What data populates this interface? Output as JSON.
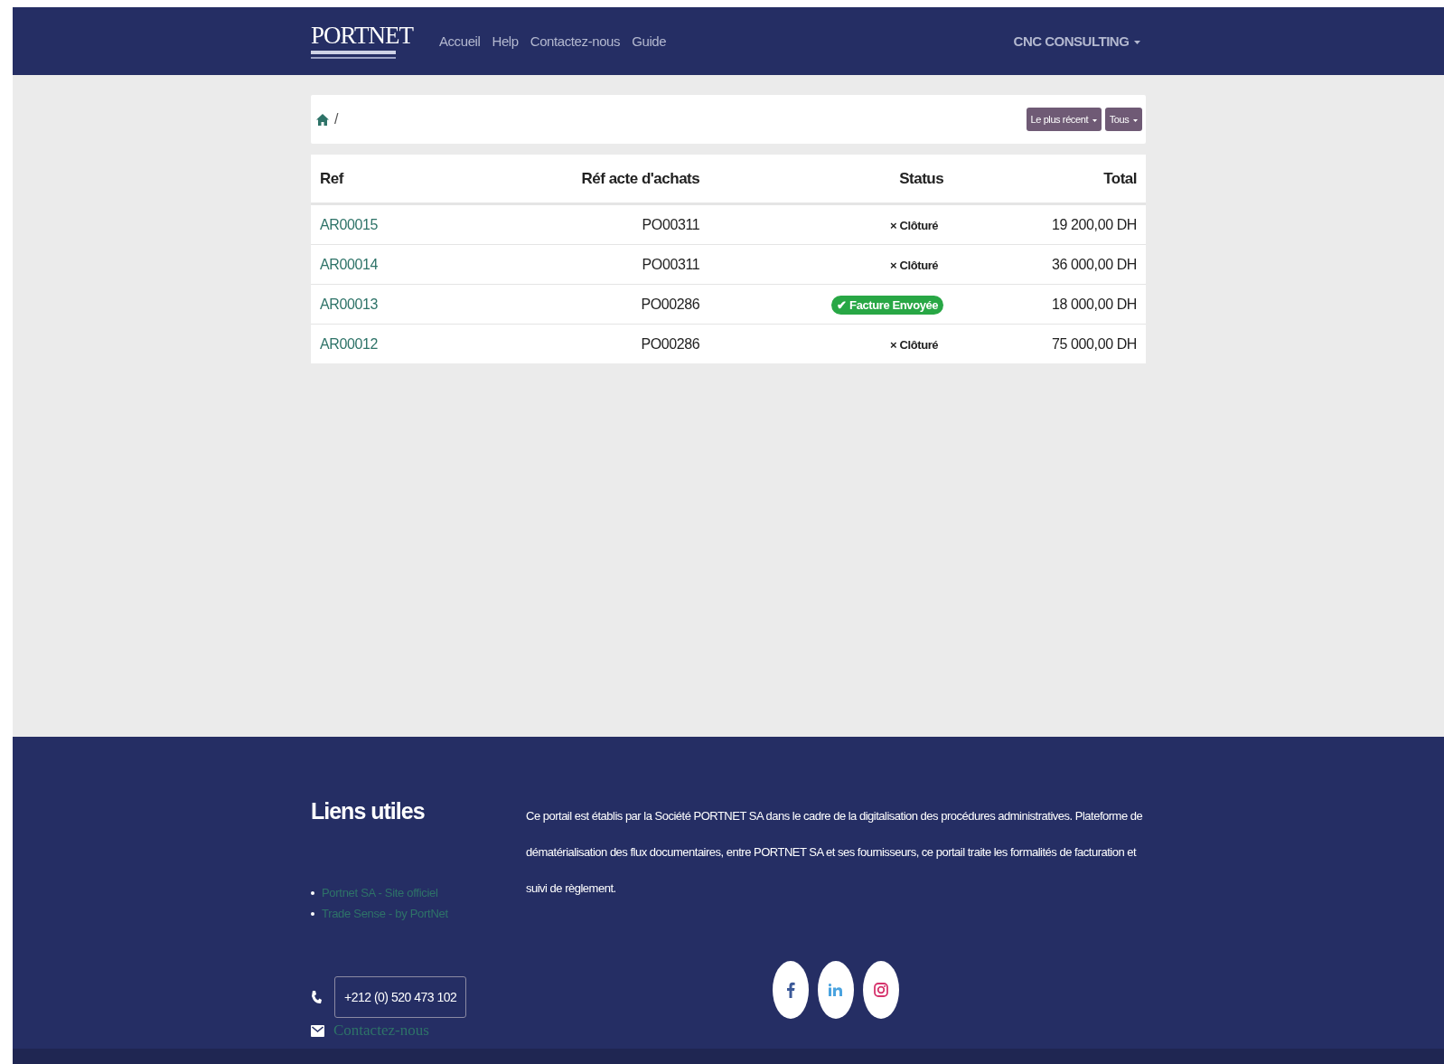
{
  "navbar": {
    "logo": "PORTNET",
    "links": [
      "Accueil",
      "Help",
      "Contactez-nous",
      "Guide"
    ],
    "user_menu": "CNC CONSULTING"
  },
  "breadcrumb": {
    "separator": "/"
  },
  "toolbar": {
    "buttons": [
      "Le plus récent",
      "Tous"
    ]
  },
  "table": {
    "columns": [
      "Ref",
      "Réf acte d'achats",
      "Status",
      "Total"
    ],
    "rows": [
      {
        "ref": "AR00015",
        "purchase_ref": "PO00311",
        "status": {
          "kind": "closed",
          "icon": "×",
          "label": "Clôturé"
        },
        "total": "19 200,00 DH"
      },
      {
        "ref": "AR00014",
        "purchase_ref": "PO00311",
        "status": {
          "kind": "closed",
          "icon": "×",
          "label": "Clôturé"
        },
        "total": "36 000,00 DH"
      },
      {
        "ref": "AR00013",
        "purchase_ref": "PO00286",
        "status": {
          "kind": "sent",
          "icon": "✔",
          "label": "Facture Envoyée"
        },
        "total": "18 000,00 DH"
      },
      {
        "ref": "AR00012",
        "purchase_ref": "PO00286",
        "status": {
          "kind": "closed",
          "icon": "×",
          "label": "Clôturé"
        },
        "total": "75 000,00 DH"
      }
    ]
  },
  "footer": {
    "heading": "Liens utiles",
    "links": [
      "Portnet SA - Site officiel",
      "Trade Sense - by PortNet"
    ],
    "description": "Ce portail est établis par la Société PORTNET SA dans le cadre de la digitalisation des procédures administratives. Plateforme de dématérialisation des flux documentaires, entre PORTNET SA et ses fournisseurs, ce portail   traite les formalités de facturation et suivi de règlement.",
    "phone": "+212 (0) 520 473 102",
    "contact_link": "Contactez-nous"
  }
}
